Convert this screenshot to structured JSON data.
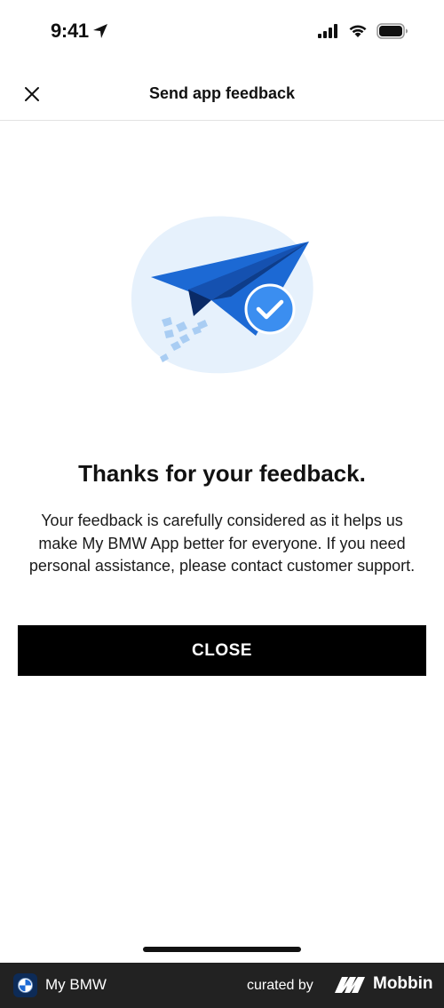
{
  "status_bar": {
    "time": "9:41",
    "icons": [
      "location-arrow-icon",
      "cellular-signal-icon",
      "wifi-icon",
      "battery-icon"
    ]
  },
  "nav": {
    "title": "Send app feedback",
    "close_icon": "close-icon"
  },
  "content": {
    "illustration": "paper-plane-check-illustration",
    "heading": "Thanks for your feedback.",
    "body": "Your feedback is carefully considered as it helps us make My BMW App better for everyone. If you need personal assistance, please contact customer support.",
    "close_button": "CLOSE"
  },
  "footer": {
    "app_name": "My BMW",
    "curated_by": "curated by",
    "brand": "Mobbin"
  },
  "colors": {
    "primary_button": "#000000",
    "illustration_blob": "#e6f1fc",
    "plane_blue": "#1c69d4",
    "check_badge": "#3b8ef0",
    "footer_bg": "#222222"
  }
}
